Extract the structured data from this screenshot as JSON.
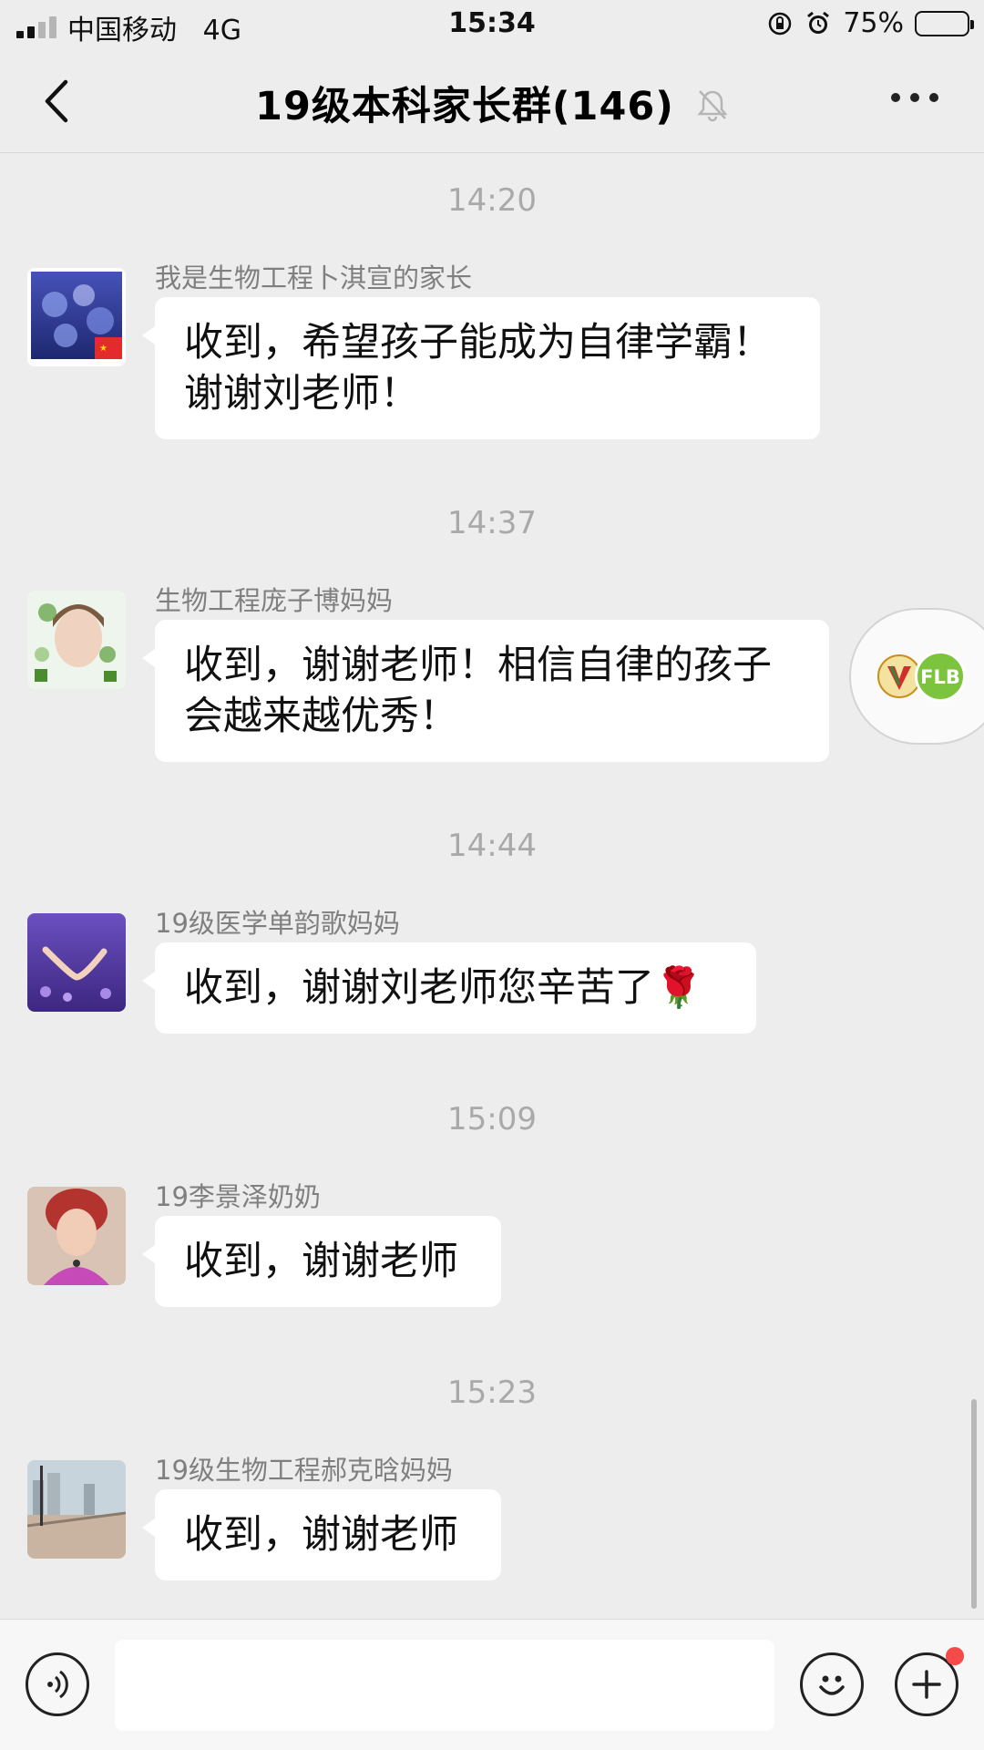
{
  "status_bar": {
    "carrier": "中国移动",
    "network": "4G",
    "time": "15:34",
    "battery_percent": "75%",
    "battery_level": 0.75,
    "icons": [
      "signal-icon",
      "rotation-lock-icon",
      "alarm-icon",
      "battery-icon"
    ]
  },
  "nav": {
    "title": "19级本科家长群(146)",
    "icons": [
      "back-chevron-icon",
      "mute-bell-icon",
      "more-dots-icon"
    ]
  },
  "messages": [
    {
      "time": "14:20",
      "sender": "我是生物工程卜淇宣的家长",
      "lines": [
        "收到，希望孩子能成为自律学霸！",
        "谢谢刘老师！"
      ]
    },
    {
      "time": "14:37",
      "sender": "生物工程庞子博妈妈",
      "lines": [
        "收到，谢谢老师！相信自律的孩子",
        "会越来越优秀！"
      ]
    },
    {
      "time": "14:44",
      "sender": "19级医学单韵歌妈妈",
      "lines": [
        "收到，谢谢刘老师您辛苦了🌹"
      ]
    },
    {
      "time": "15:09",
      "sender": "19李景泽奶奶",
      "lines": [
        "收到，谢谢老师"
      ]
    },
    {
      "time": "15:23",
      "sender": "19级生物工程郝克晗妈妈",
      "lines": [
        "收到，谢谢老师"
      ]
    }
  ],
  "floating_widget": {
    "logo_text": "FLB"
  },
  "input_bar": {
    "value": "",
    "icons": [
      "voice-icon",
      "emoji-icon",
      "plus-icon"
    ]
  },
  "colors": {
    "background": "#ededed",
    "bubble": "#ffffff",
    "timestamp": "#a9a9a9",
    "sender": "#7f7f7f",
    "notification_dot": "#f44a4a"
  }
}
